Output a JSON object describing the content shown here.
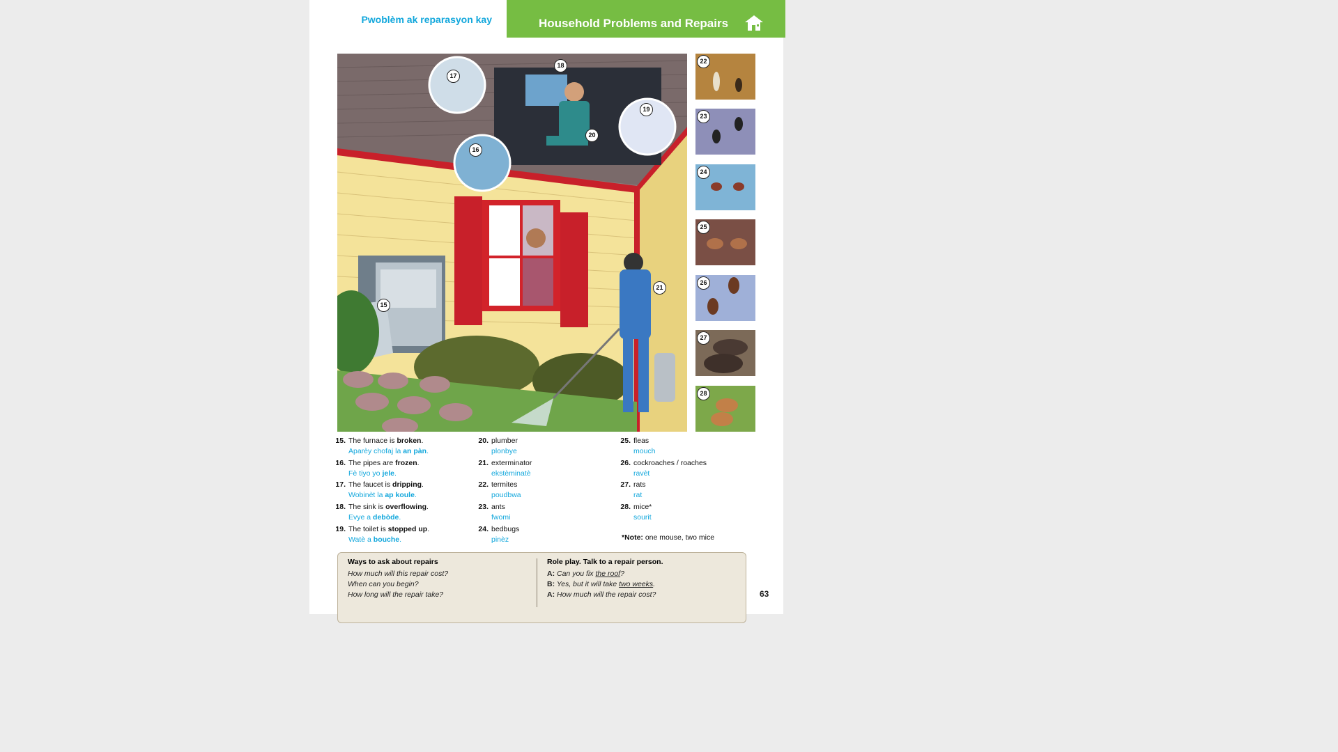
{
  "header": {
    "title_ht": "Pwoblèm ak reparasyon kay",
    "title_en": "Household Problems and Repairs",
    "accent_color": "#76bd43",
    "icon": "house-icon"
  },
  "illustration": {
    "callouts": [
      "15",
      "16",
      "17",
      "18",
      "19",
      "20",
      "21"
    ]
  },
  "pests": [
    {
      "num": "22",
      "icon": "termites-icon"
    },
    {
      "num": "23",
      "icon": "ants-icon"
    },
    {
      "num": "24",
      "icon": "bedbugs-icon"
    },
    {
      "num": "25",
      "icon": "fleas-icon"
    },
    {
      "num": "26",
      "icon": "cockroaches-icon"
    },
    {
      "num": "27",
      "icon": "rats-icon"
    },
    {
      "num": "28",
      "icon": "mice-icon"
    }
  ],
  "vocab": [
    {
      "num": "15.",
      "en_pre": "The furnace is ",
      "en_bold": "broken",
      "en_post": ".",
      "ht_pre": "Aparèy chofaj la ",
      "ht_bold": "an pàn",
      "ht_post": "."
    },
    {
      "num": "16.",
      "en_pre": "The pipes are ",
      "en_bold": "frozen",
      "en_post": ".",
      "ht_pre": "Fè tiyo yo ",
      "ht_bold": "jele",
      "ht_post": "."
    },
    {
      "num": "17.",
      "en_pre": "The faucet is ",
      "en_bold": "dripping",
      "en_post": ".",
      "ht_pre": "Wobinèt la ",
      "ht_bold": "ap koule",
      "ht_post": "."
    },
    {
      "num": "18.",
      "en_pre": "The sink is ",
      "en_bold": "overflowing",
      "en_post": ".",
      "ht_pre": "Evye a ",
      "ht_bold": "debòde",
      "ht_post": "."
    },
    {
      "num": "19.",
      "en_pre": "The toilet is ",
      "en_bold": "stopped up",
      "en_post": ".",
      "ht_pre": "Watè a ",
      "ht_bold": "bouche",
      "ht_post": "."
    },
    {
      "num": "20.",
      "en_pre": "plumber",
      "en_bold": "",
      "en_post": "",
      "ht_pre": "plonbye",
      "ht_bold": "",
      "ht_post": ""
    },
    {
      "num": "21.",
      "en_pre": "exterminator",
      "en_bold": "",
      "en_post": "",
      "ht_pre": "ekstèminatè",
      "ht_bold": "",
      "ht_post": ""
    },
    {
      "num": "22.",
      "en_pre": "termites",
      "en_bold": "",
      "en_post": "",
      "ht_pre": "poudbwa",
      "ht_bold": "",
      "ht_post": ""
    },
    {
      "num": "23.",
      "en_pre": "ants",
      "en_bold": "",
      "en_post": "",
      "ht_pre": "fwomi",
      "ht_bold": "",
      "ht_post": ""
    },
    {
      "num": "24.",
      "en_pre": "bedbugs",
      "en_bold": "",
      "en_post": "",
      "ht_pre": "pinèz",
      "ht_bold": "",
      "ht_post": ""
    },
    {
      "num": "25.",
      "en_pre": "fleas",
      "en_bold": "",
      "en_post": "",
      "ht_pre": "mouch",
      "ht_bold": "",
      "ht_post": ""
    },
    {
      "num": "26.",
      "en_pre": "cockroaches / roaches",
      "en_bold": "",
      "en_post": "",
      "ht_pre": "ravèt",
      "ht_bold": "",
      "ht_post": ""
    },
    {
      "num": "27.",
      "en_pre": "rats",
      "en_bold": "",
      "en_post": "",
      "ht_pre": "rat",
      "ht_bold": "",
      "ht_post": ""
    },
    {
      "num": "28.",
      "en_pre": "mice*",
      "en_bold": "",
      "en_post": "",
      "ht_pre": "sourit",
      "ht_bold": "",
      "ht_post": ""
    }
  ],
  "note": {
    "label": "*Note:",
    "text": " one mouse, two mice"
  },
  "box": {
    "left_title": "Ways to ask about repairs",
    "left_lines": [
      "How much will this repair cost?",
      "When can you begin?",
      "How long will the repair take?"
    ],
    "right_title": "Role play. Talk to a repair person.",
    "dialog": [
      {
        "speaker": "A:",
        "pre": " Can you fix ",
        "u": "the roof",
        "post": "?"
      },
      {
        "speaker": "B:",
        "pre": " Yes, but it will take ",
        "u": "two weeks",
        "post": "."
      },
      {
        "speaker": "A:",
        "pre": " How much will the repair cost?",
        "u": "",
        "post": ""
      }
    ]
  },
  "page_number": "63"
}
